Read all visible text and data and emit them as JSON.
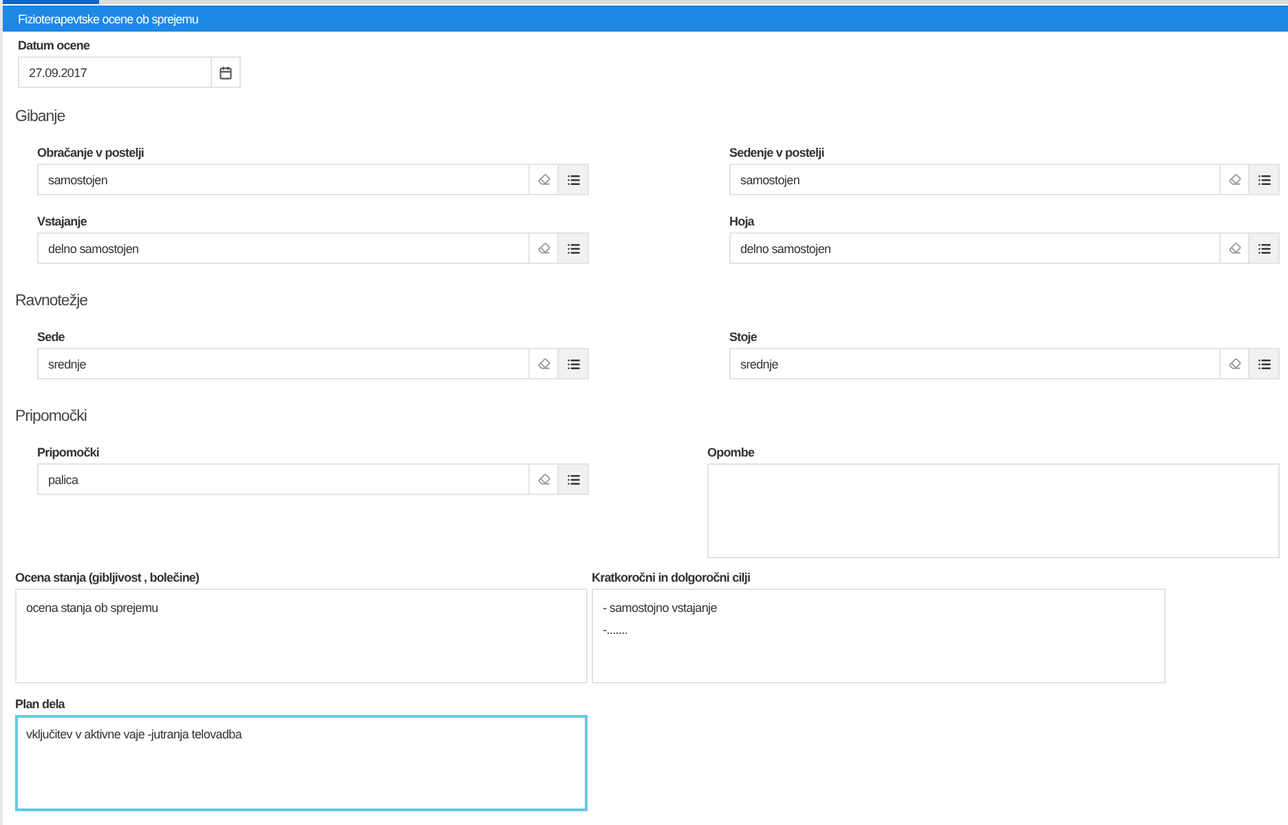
{
  "header": {
    "title": "Fizioterapevtske ocene ob sprejemu"
  },
  "date_field": {
    "label": "Datum ocene",
    "value": "27.09.2017"
  },
  "sections": [
    {
      "title": "Gibanje",
      "fields": [
        {
          "label": "Obračanje v postelji",
          "value": "samostojen"
        },
        {
          "label": "Sedenje v postelji",
          "value": "samostojen"
        },
        {
          "label": "Vstajanje",
          "value": "delno samostojen"
        },
        {
          "label": "Hoja",
          "value": "delno samostojen"
        }
      ]
    },
    {
      "title": "Ravnotežje",
      "fields": [
        {
          "label": "Sede",
          "value": "srednje"
        },
        {
          "label": "Stoje",
          "value": "srednje"
        }
      ]
    },
    {
      "title": "Pripomočki",
      "fields": [
        {
          "label": "Pripomočki",
          "value": "palica"
        }
      ],
      "notes": {
        "label": "Opombe"
      }
    }
  ],
  "text_areas": [
    {
      "label": "Ocena stanja (gibljivost , bolečine)",
      "value": "ocena stanja ob sprejemu",
      "focused": false
    },
    {
      "label": "Kratkoročni in dolgoročni cilji",
      "value": "- samostojno vstajanje\n-.......",
      "focused": false
    },
    {
      "label": "Plan dela",
      "value": "vključitev v aktivne vaje -jutranja telovadba",
      "focused": true
    }
  ]
}
